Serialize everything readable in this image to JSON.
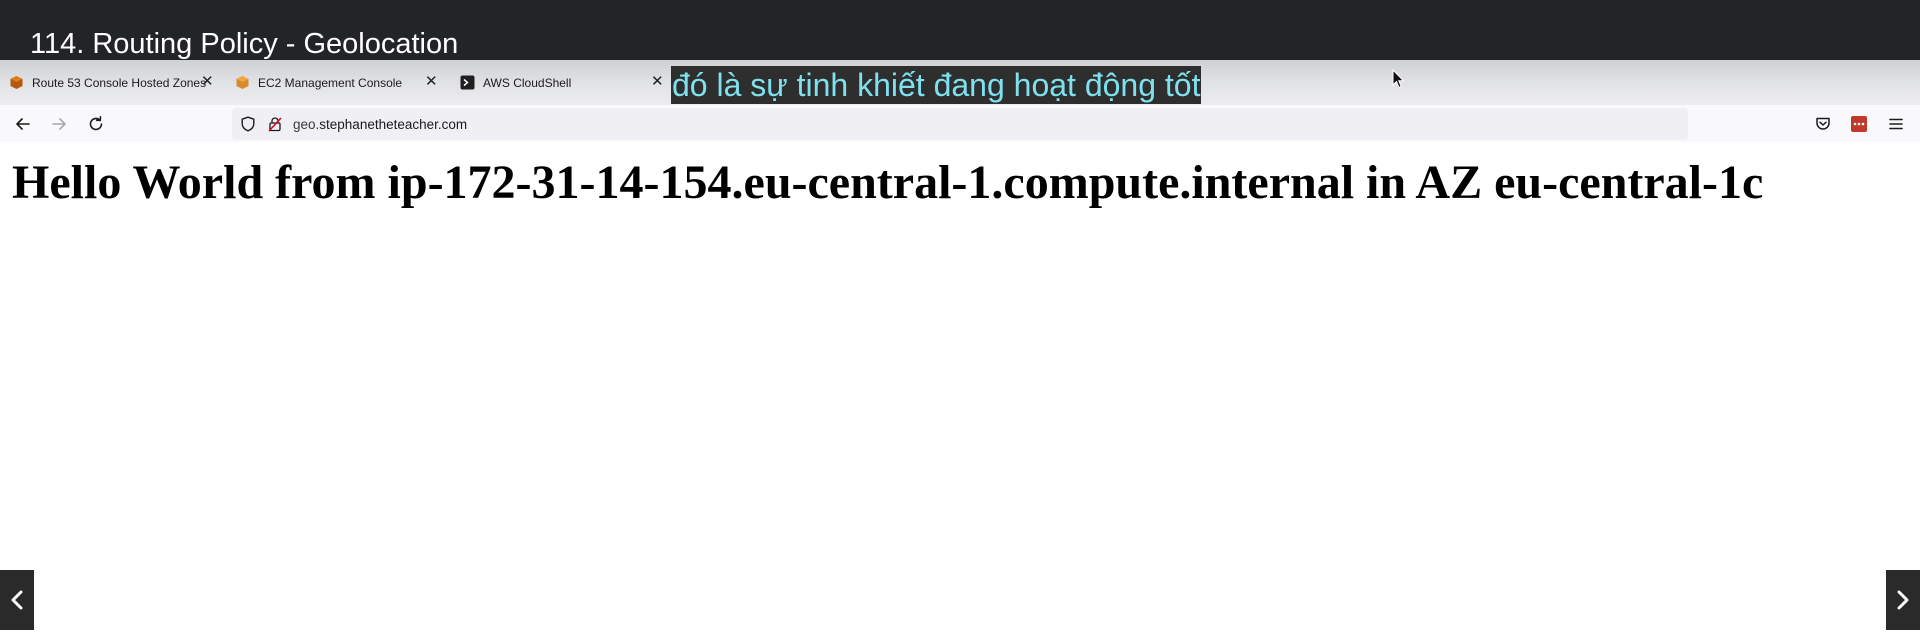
{
  "video": {
    "title": "114. Routing Policy - Geolocation",
    "subtitle": "đó là sự tinh khiết đang hoạt động tốt"
  },
  "browser": {
    "tabs": [
      {
        "label": "Route 53 Console Hosted Zones",
        "icon": "route53-icon"
      },
      {
        "label": "EC2 Management Console",
        "icon": "ec2-icon"
      },
      {
        "label": "AWS CloudShell",
        "icon": "cloudshell-icon"
      },
      {
        "label": "",
        "icon": "blank"
      }
    ],
    "url": {
      "prefix": "geo.",
      "host": "stephanetheteacher.com"
    }
  },
  "page": {
    "heading": "Hello World from ip-172-31-14-154.eu-central-1.compute.internal in AZ eu-central-1c"
  },
  "colors": {
    "title_bar": "#222428",
    "subtitle_text": "#7fe0ee",
    "subtitle_bg": "#2e2e2e",
    "extension_red": "#c0392b",
    "aws_orange": "#e07b1a"
  }
}
